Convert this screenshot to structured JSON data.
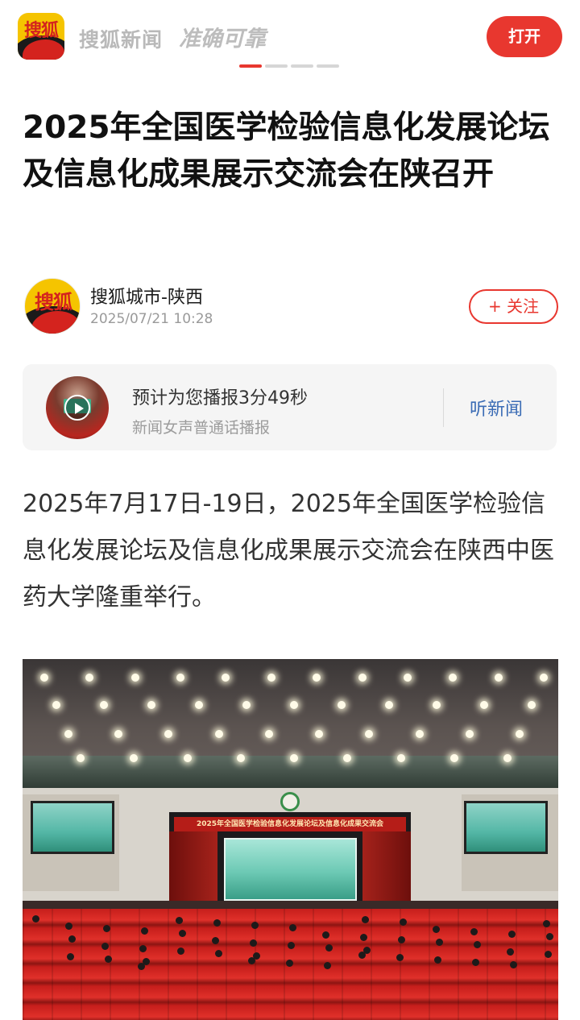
{
  "header": {
    "logo_text": "搜狐",
    "brand": "搜狐新闻",
    "slogan": "准确可靠",
    "open_label": "打开",
    "carousel_total": 4,
    "carousel_active": 1
  },
  "article": {
    "title": "2025年全国医学检验信息化发展论坛及信息化成果展示交流会在陕召开",
    "paragraph": "2025年7月17日-19日，2025年全国医学检验信息化发展论坛及信息化成果展示交流会在陕西中医药大学隆重举行。",
    "image": {
      "banner_text": "2025年全国医学检验信息化发展论坛及信息化成果交流会"
    }
  },
  "author": {
    "avatar_text": "搜狐",
    "name": "搜狐城市-陕西",
    "time": "2025/07/21 10:28",
    "follow_label": "+ 关注"
  },
  "audio": {
    "estimate": "预计为您播报3分49秒",
    "voice": "新闻女声普通话播报",
    "listen_label": "听新闻"
  },
  "colors": {
    "accent": "#e8372f",
    "listen_link": "#3b6cb5",
    "logo_yellow": "#f5c400"
  }
}
